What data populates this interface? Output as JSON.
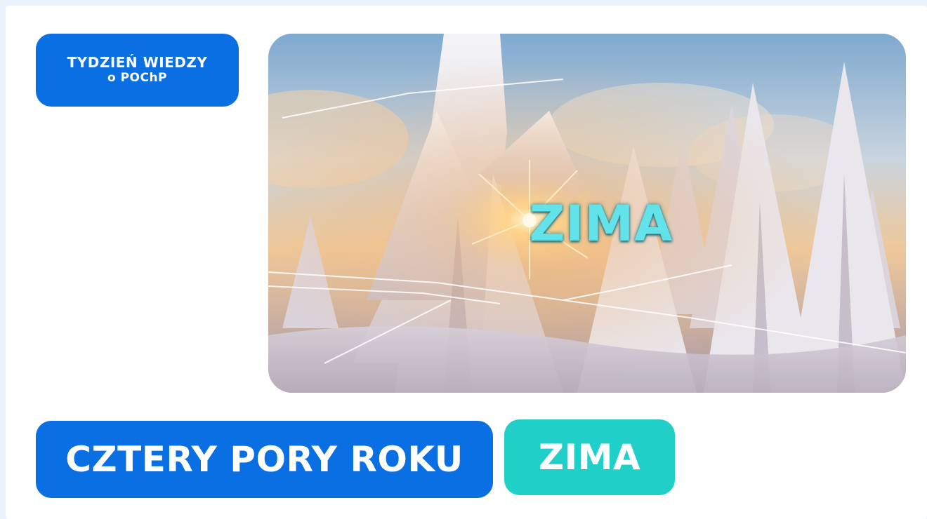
{
  "badge": {
    "line1": "TYDZIEŃ WIEDZY",
    "line2": "o POChP"
  },
  "hero": {
    "title": "ZIMA",
    "image": "snowy-forest-sunburst"
  },
  "tags": {
    "series": "CZTERY PORY ROKU",
    "season": "ZIMA"
  },
  "colors": {
    "primary_blue": "#0a6fe3",
    "teal": "#20d0c8",
    "title_cyan": "#62e3ea",
    "background": "#e9f1fb"
  }
}
